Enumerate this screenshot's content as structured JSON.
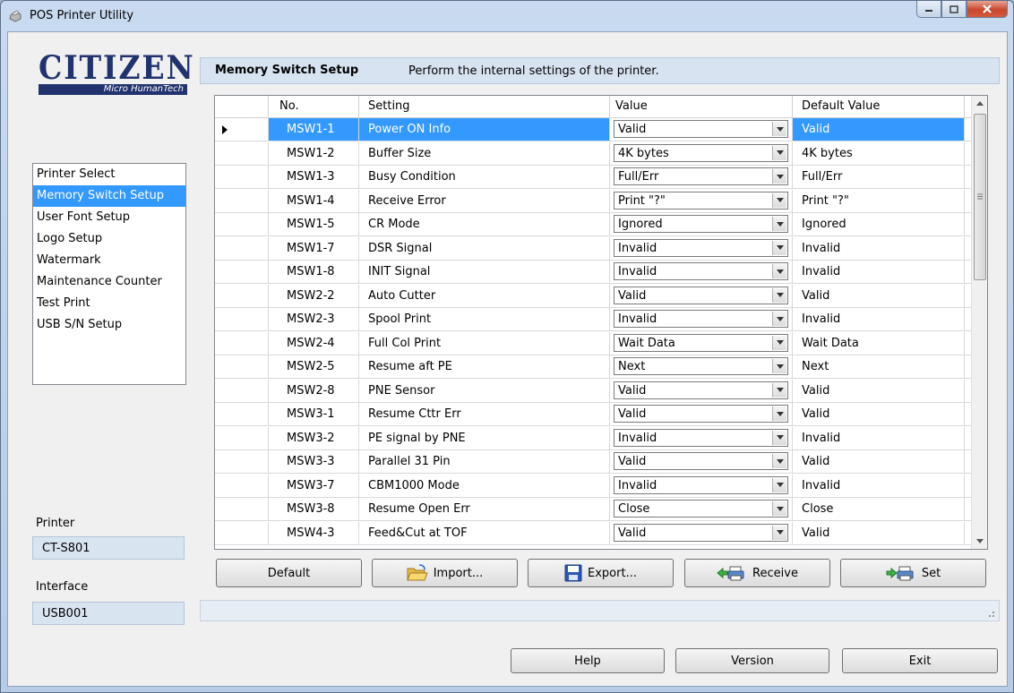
{
  "window": {
    "title": "POS Printer Utility"
  },
  "logo": {
    "brand": "CITIZEN",
    "sub": "Micro HumanTech"
  },
  "nav": {
    "items": [
      {
        "label": "Printer Select",
        "selected": false
      },
      {
        "label": "Memory Switch Setup",
        "selected": true
      },
      {
        "label": "User Font Setup",
        "selected": false
      },
      {
        "label": "Logo Setup",
        "selected": false
      },
      {
        "label": "Watermark",
        "selected": false
      },
      {
        "label": "Maintenance Counter",
        "selected": false
      },
      {
        "label": "Test Print",
        "selected": false
      },
      {
        "label": "USB S/N Setup",
        "selected": false
      }
    ]
  },
  "side": {
    "printer_label": "Printer",
    "printer_value": "CT-S801",
    "interface_label": "Interface",
    "interface_value": "USB001"
  },
  "header": {
    "title": "Memory Switch Setup",
    "description": "Perform the internal settings of the printer."
  },
  "grid": {
    "columns": {
      "no": "No.",
      "setting": "Setting",
      "value": "Value",
      "default": "Default Value"
    },
    "rows": [
      {
        "no": "MSW1-1",
        "setting": "Power ON Info",
        "value": "Valid",
        "default": "Valid",
        "selected": true
      },
      {
        "no": "MSW1-2",
        "setting": "Buffer Size",
        "value": "4K bytes",
        "default": "4K bytes"
      },
      {
        "no": "MSW1-3",
        "setting": "Busy Condition",
        "value": "Full/Err",
        "default": "Full/Err"
      },
      {
        "no": "MSW1-4",
        "setting": "Receive Error",
        "value": "Print \"?\"",
        "default": "Print \"?\""
      },
      {
        "no": "MSW1-5",
        "setting": "CR Mode",
        "value": "Ignored",
        "default": "Ignored"
      },
      {
        "no": "MSW1-7",
        "setting": "DSR Signal",
        "value": "Invalid",
        "default": "Invalid"
      },
      {
        "no": "MSW1-8",
        "setting": "INIT Signal",
        "value": "Invalid",
        "default": "Invalid"
      },
      {
        "no": "MSW2-2",
        "setting": "Auto Cutter",
        "value": "Valid",
        "default": "Valid"
      },
      {
        "no": "MSW2-3",
        "setting": "Spool Print",
        "value": "Invalid",
        "default": "Invalid"
      },
      {
        "no": "MSW2-4",
        "setting": "Full Col Print",
        "value": "Wait Data",
        "default": "Wait Data"
      },
      {
        "no": "MSW2-5",
        "setting": "Resume aft PE",
        "value": "Next",
        "default": "Next"
      },
      {
        "no": "MSW2-8",
        "setting": "PNE Sensor",
        "value": "Valid",
        "default": "Valid"
      },
      {
        "no": "MSW3-1",
        "setting": "Resume Cttr Err",
        "value": "Valid",
        "default": "Valid"
      },
      {
        "no": "MSW3-2",
        "setting": "PE signal by PNE",
        "value": "Invalid",
        "default": "Invalid"
      },
      {
        "no": "MSW3-3",
        "setting": "Parallel 31 Pin",
        "value": "Valid",
        "default": "Valid"
      },
      {
        "no": "MSW3-7",
        "setting": "CBM1000 Mode",
        "value": "Invalid",
        "default": "Invalid"
      },
      {
        "no": "MSW3-8",
        "setting": "Resume Open Err",
        "value": "Close",
        "default": "Close"
      },
      {
        "no": "MSW4-3",
        "setting": "Feed&Cut at TOF",
        "value": "Valid",
        "default": "Valid"
      }
    ]
  },
  "actions": {
    "default": "Default",
    "import": "Import...",
    "export": "Export...",
    "receive": "Receive",
    "set": "Set"
  },
  "footer": {
    "help": "Help",
    "version": "Version",
    "exit": "Exit"
  },
  "colors": {
    "selection": "#3399ff",
    "logo_blue": "#21326e"
  }
}
